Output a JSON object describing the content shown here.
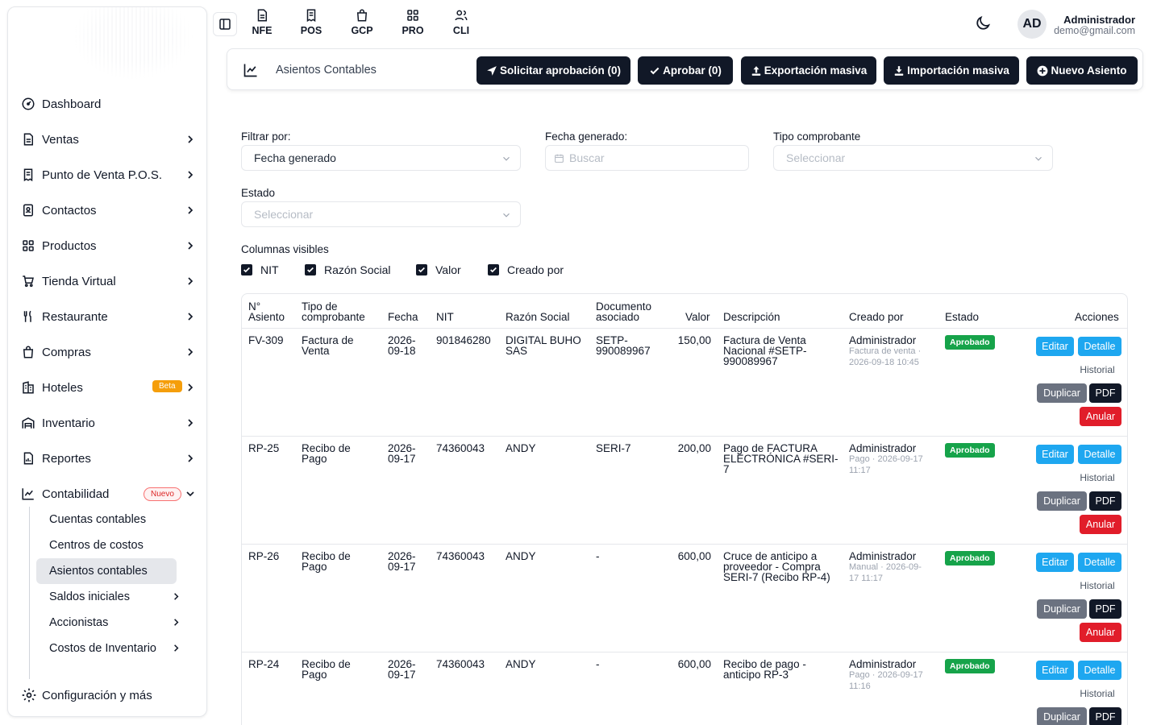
{
  "sidebar": {
    "items": [
      {
        "label": "Dashboard",
        "icon": "dashboard-icon"
      },
      {
        "label": "Ventas",
        "icon": "document-icon"
      },
      {
        "label": "Punto de Venta P.O.S.",
        "icon": "receipt-icon"
      },
      {
        "label": "Contactos",
        "icon": "contacts-icon"
      },
      {
        "label": "Productos",
        "icon": "grid-icon"
      },
      {
        "label": "Tienda Virtual",
        "icon": "cart-icon"
      },
      {
        "label": "Restaurante",
        "icon": "utensils-icon"
      },
      {
        "label": "Compras",
        "icon": "bag-icon"
      },
      {
        "label": "Hoteles",
        "icon": "building-icon",
        "badge": "Beta"
      },
      {
        "label": "Inventario",
        "icon": "warehouse-icon"
      },
      {
        "label": "Reportes",
        "icon": "report-icon"
      },
      {
        "label": "Contabilidad",
        "icon": "chart-icon",
        "badge": "Nuevo"
      }
    ],
    "subitems": [
      {
        "label": "Cuentas contables"
      },
      {
        "label": "Centros de costos"
      },
      {
        "label": "Asientos contables"
      },
      {
        "label": "Saldos iniciales"
      },
      {
        "label": "Accionistas"
      },
      {
        "label": "Costos de Inventario"
      }
    ],
    "config_label": "Configuración y más"
  },
  "topbar": {
    "quick": [
      {
        "label": "NFE"
      },
      {
        "label": "POS"
      },
      {
        "label": "GCP"
      },
      {
        "label": "PRO"
      },
      {
        "label": "CLI"
      }
    ],
    "avatar": "AD",
    "user_name": "Administrador",
    "user_email": "demo@gmail.com"
  },
  "header": {
    "title": "Asientos Contables",
    "buttons": {
      "request": "Solicitar aprobación (0)",
      "approve": "Aprobar (0)",
      "export": "Exportación masiva",
      "import": "Importación masiva",
      "new": "Nuevo Asiento"
    }
  },
  "filters": {
    "filter_by_label": "Filtrar por:",
    "filter_by_value": "Fecha generado",
    "date_label": "Fecha generado:",
    "date_placeholder": "Buscar",
    "type_label": "Tipo comprobante",
    "type_placeholder": "Seleccionar",
    "state_label": "Estado",
    "state_placeholder": "Seleccionar",
    "columns_label": "Columnas visibles",
    "columns": [
      "NIT",
      "Razón Social",
      "Valor",
      "Creado por"
    ]
  },
  "table": {
    "headers": {
      "num": [
        "N°",
        "Asiento"
      ],
      "type": [
        "Tipo de",
        "comprobante"
      ],
      "date": "Fecha",
      "nit": "NIT",
      "name": "Razón Social",
      "doc": [
        "Documento",
        "asociado"
      ],
      "value": "Valor",
      "desc": "Descripción",
      "by": "Creado por",
      "state": "Estado",
      "actions": "Acciones"
    },
    "actions": {
      "edit": "Editar",
      "detail": "Detalle",
      "history": "Historial",
      "duplicate": "Duplicar",
      "pdf": "PDF",
      "cancel": "Anular"
    },
    "rows": [
      {
        "num": "FV-309",
        "type": [
          "Factura de",
          "Venta"
        ],
        "date": [
          "2026-",
          "09-18"
        ],
        "nit": "901846280",
        "name": [
          "DIGITAL BUHO",
          "SAS"
        ],
        "doc": [
          "SETP-",
          "990089967"
        ],
        "value": "150,00",
        "desc": [
          "Factura de Venta",
          "Nacional #SETP-",
          "990089967"
        ],
        "by": "Administrador",
        "by_meta": [
          "Factura de venta ·",
          "2026-09-18 10:45"
        ],
        "state": "Aprobado"
      },
      {
        "num": "RP-25",
        "type": [
          "Recibo de",
          "Pago"
        ],
        "date": [
          "2026-",
          "09-17"
        ],
        "nit": "74360043",
        "name": [
          "ANDY"
        ],
        "doc": [
          "SERI-7"
        ],
        "value": "200,00",
        "desc": [
          "Pago de FACTURA",
          "ELECTRÓNICA #SERI-",
          "7"
        ],
        "by": "Administrador",
        "by_meta": [
          "Pago · 2026-09-17",
          "11:17"
        ],
        "state": "Aprobado"
      },
      {
        "num": "RP-26",
        "type": [
          "Recibo de",
          "Pago"
        ],
        "date": [
          "2026-",
          "09-17"
        ],
        "nit": "74360043",
        "name": [
          "ANDY"
        ],
        "doc": [
          "-"
        ],
        "value": "600,00",
        "desc": [
          "Cruce de anticipo a",
          "proveedor - Compra",
          "SERI-7 (Recibo RP-4)"
        ],
        "by": "Administrador",
        "by_meta": [
          "Manual · 2026-09-",
          "17 11:17"
        ],
        "state": "Aprobado"
      },
      {
        "num": "RP-24",
        "type": [
          "Recibo de",
          "Pago"
        ],
        "date": [
          "2026-",
          "09-17"
        ],
        "nit": "74360043",
        "name": [
          "ANDY"
        ],
        "doc": [
          "-"
        ],
        "value": "600,00",
        "desc": [
          "Recibo de pago -",
          "anticipo RP-3"
        ],
        "by": "Administrador",
        "by_meta": [
          "Pago · 2026-09-17",
          "11:16"
        ],
        "state": "Aprobado"
      }
    ]
  },
  "colors": {
    "dark": "#111827",
    "blue": "#1ea7f0",
    "green": "#16a34a",
    "red": "#e11d2a",
    "gray": "#6b7280"
  }
}
